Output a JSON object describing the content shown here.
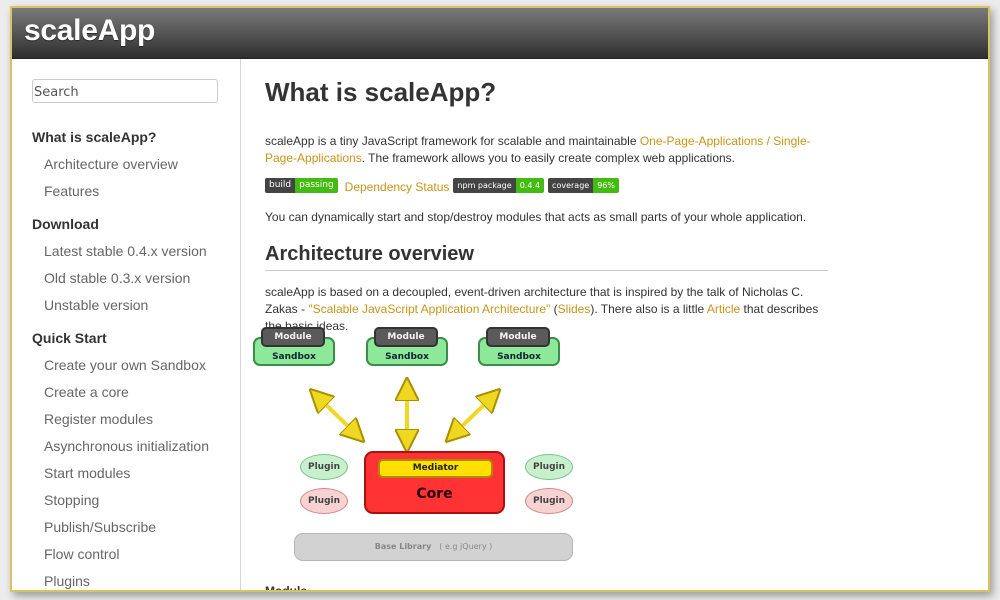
{
  "header": {
    "brand": "scaleApp"
  },
  "sidebar": {
    "search_placeholder": "Search",
    "sections": [
      {
        "title": "What is scaleApp?",
        "items": [
          "Architecture overview",
          "Features"
        ]
      },
      {
        "title": "Download",
        "items": [
          "Latest stable 0.4.x version",
          "Old stable 0.3.x version",
          "Unstable version"
        ]
      },
      {
        "title": "Quick Start",
        "items": [
          "Create your own Sandbox",
          "Create a core",
          "Register modules",
          "Asynchronous initialization",
          "Start modules",
          "Stopping",
          "Publish/Subscribe",
          "Flow control",
          "Plugins"
        ]
      }
    ]
  },
  "main": {
    "title": "What is scaleApp?",
    "intro": {
      "text1": "scaleApp is a tiny JavaScript framework for scalable and maintainable ",
      "link1": "One-Page-Applications / Single-Page-Applications",
      "text2": ". The framework allows you to easily create complex web applications."
    },
    "badges": {
      "build": {
        "label": "build",
        "value": "passing"
      },
      "dependency_link": "Dependency Status",
      "npm": {
        "label": "npm package",
        "value": "0.4.4"
      },
      "coverage": {
        "label": "coverage",
        "value": "96%"
      },
      "colors": {
        "dark": "#444444",
        "green": "#44bb11"
      }
    },
    "para2": "You can dynamically start and stop/destroy modules that acts as small parts of your whole application.",
    "arch": {
      "heading": "Architecture overview",
      "text1": "scaleApp is based on a decoupled, event-driven architecture that is inspired by the talk of Nicholas C. Zakas - ",
      "link1": "\"Scalable JavaScript Application Architecture\"",
      "text2": " (",
      "link2": "Slides",
      "text3": "). There also is a little ",
      "link3": "Article",
      "text4": " that describes the basic ideas."
    },
    "diagram": {
      "modules": [
        {
          "module": "Module",
          "sandbox": "Sandbox"
        },
        {
          "module": "Module",
          "sandbox": "Sandbox"
        },
        {
          "module": "Module",
          "sandbox": "Sandbox"
        }
      ],
      "plugins": [
        "Plugin",
        "Plugin",
        "Plugin",
        "Plugin"
      ],
      "mediator": "Mediator",
      "core": "Core",
      "base_library": "Base Library",
      "base_example": "( e.g jQuery )"
    },
    "next_heading": "Module"
  },
  "theme": {
    "link_color": "#c89418",
    "window_border": "#d9c35e"
  }
}
